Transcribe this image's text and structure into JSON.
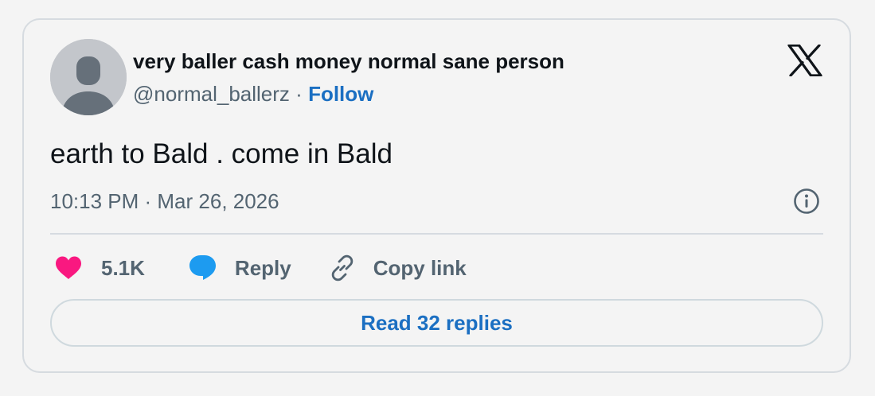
{
  "author": {
    "display_name": "very baller cash money normal sane person",
    "handle": "@normal_ballerz",
    "separator": "·",
    "follow_label": "Follow"
  },
  "tweet": {
    "text": "earth to Bald . come in Bald",
    "timestamp": "10:13 PM · Mar 26, 2026"
  },
  "actions": {
    "like_count": "5.1K",
    "reply_label": "Reply",
    "copy_link_label": "Copy link"
  },
  "read_replies_label": "Read 32 replies",
  "icons": {
    "platform_logo": "x-logo-icon",
    "info": "info-icon",
    "like": "heart-icon",
    "reply": "speech-bubble-icon",
    "copy": "link-icon"
  },
  "colors": {
    "link_blue": "#1b6fc2",
    "heart_pink": "#f91880",
    "reply_blue": "#1d9bf0",
    "muted_text": "#536471",
    "primary_text": "#0f1419"
  }
}
